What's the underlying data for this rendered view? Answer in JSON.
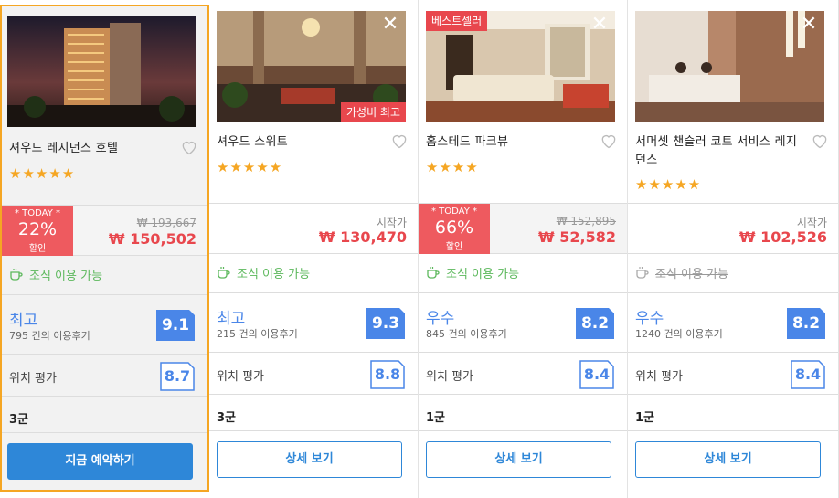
{
  "colors": {
    "accent_blue": "#4a86e8",
    "button_blue": "#2e87d8",
    "price_red": "#e8474d",
    "deal_red": "#ee5a5f",
    "star_orange": "#f5a623",
    "breakfast_green": "#5cb85c",
    "selected_border": "#f5a623"
  },
  "hotels": [
    {
      "name": "셔우드 레지던스 호텔",
      "stars": "★★★★★",
      "today_label": "* TODAY *",
      "discount": "22%",
      "discount_suffix": "할인",
      "original_price": "₩ 193,667",
      "final_price": "₩ 150,502",
      "breakfast": "조식 이용 가능",
      "rating_word": "최고",
      "review_count": "795 건의 이용후기",
      "score": "9.1",
      "location_label": "위치 평가",
      "location_score": "8.7",
      "district": "3군",
      "button": "지금 예약하기"
    },
    {
      "name": "셔우드 스위트",
      "badge": "가성비 최고",
      "stars": "★★★★★",
      "start_label": "시작가",
      "final_price": "₩ 130,470",
      "breakfast": "조식 이용 가능",
      "rating_word": "최고",
      "review_count": "215 건의 이용후기",
      "score": "9.3",
      "location_label": "위치 평가",
      "location_score": "8.8",
      "district": "3군",
      "button": "상세 보기"
    },
    {
      "name": "홈스테드 파크뷰",
      "badge": "베스트셀러",
      "stars": "★★★★",
      "today_label": "* TODAY *",
      "discount": "66%",
      "discount_suffix": "할인",
      "original_price": "₩ 152,895",
      "final_price": "₩ 52,582",
      "breakfast": "조식 이용 가능",
      "rating_word": "우수",
      "review_count": "845 건의 이용후기",
      "score": "8.2",
      "location_label": "위치 평가",
      "location_score": "8.4",
      "district": "1군",
      "button": "상세 보기"
    },
    {
      "name": "서머셋 챈슬러 코트 서비스 레지던스",
      "stars": "★★★★★",
      "start_label": "시작가",
      "final_price": "₩ 102,526",
      "breakfast": "조식 이용 가능",
      "rating_word": "우수",
      "review_count": "1240 건의 이용후기",
      "score": "8.2",
      "location_label": "위치 평가",
      "location_score": "8.4",
      "district": "1군",
      "button": "상세 보기"
    }
  ],
  "icons": {
    "close": "close-icon",
    "heart": "heart-icon",
    "cup": "coffee-cup-icon"
  },
  "close_glyph": "✕"
}
